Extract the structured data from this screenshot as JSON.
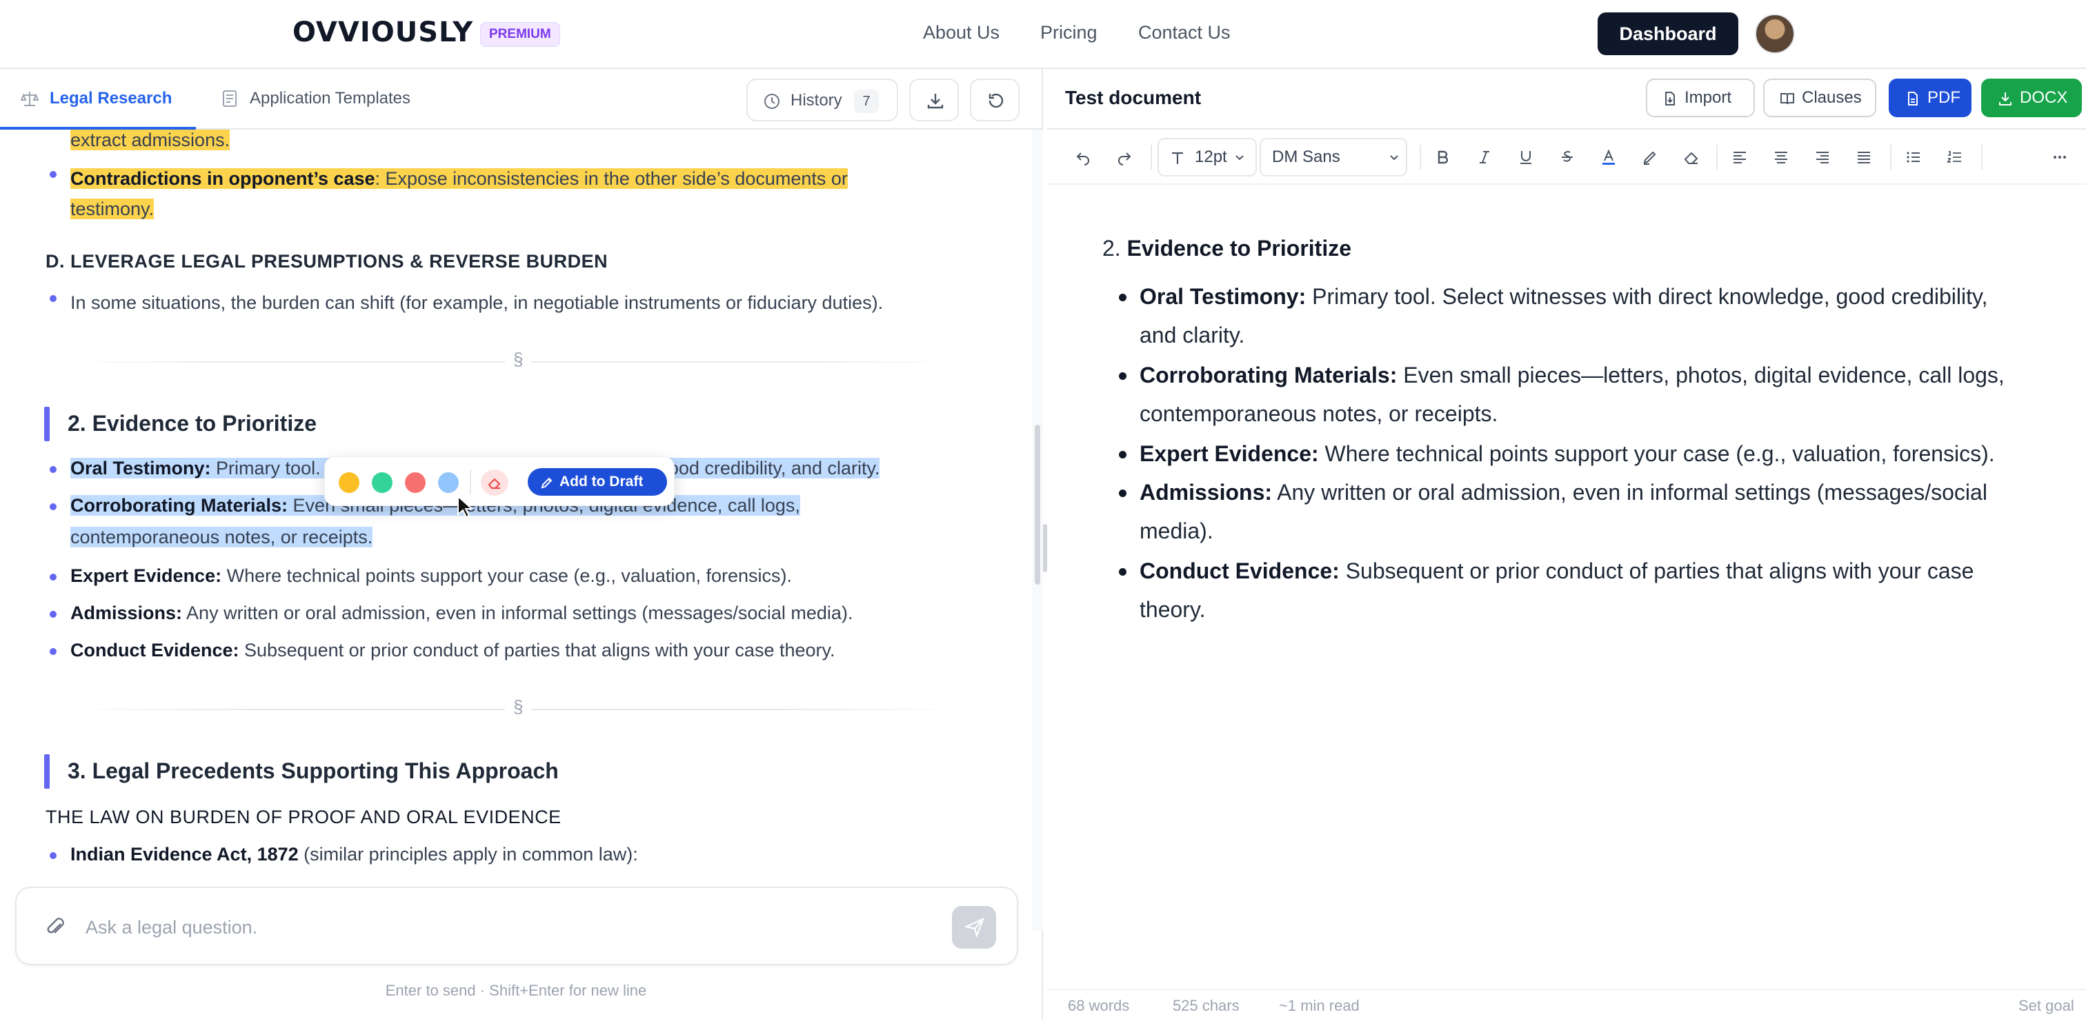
{
  "nav": {
    "logo": "OVVIOUSLY",
    "badge": "PREMIUM",
    "links": [
      "About Us",
      "Pricing",
      "Contact Us"
    ],
    "dashboard": "Dashboard"
  },
  "left": {
    "tabs": [
      "Legal Research",
      "Application Templates"
    ],
    "history_label": "History",
    "history_count": "7",
    "content": {
      "frag_top": "extract admissions.",
      "contradictions_bold": "Contradictions in opponent’s case",
      "contradictions_rest_1": ": Expose inconsistencies in the other side’s documents or",
      "contradictions_rest_2": "testimony.",
      "leverage_heading": "D. LEVERAGE LEGAL PRESUMPTIONS & REVERSE BURDEN",
      "leverage_item": "In some situations, the burden can shift (for example, in negotiable instruments or fiduciary duties).",
      "section_mark": "§",
      "section2_title": "2. Evidence to Prioritize",
      "items": [
        {
          "bold": "Oral Testimony:",
          "text_1": " Primary tool. Select witnesses with direct knowledge, good credibility, and clarity.",
          "text_2": ""
        },
        {
          "bold": "Corroborating Materials:",
          "text_1": " Even small pieces—letters, photos, digital evidence, call logs,",
          "text_2": "contemporaneous notes, or receipts."
        },
        {
          "bold": "Expert Evidence:",
          "text_1": " Where technical points support your case (e.g., valuation, forensics).",
          "text_2": ""
        },
        {
          "bold": "Admissions:",
          "text_1": " Any written or oral admission, even in informal settings (messages/social media).",
          "text_2": ""
        },
        {
          "bold": "Conduct Evidence:",
          "text_1": " Subsequent or prior conduct of parties that aligns with your case theory.",
          "text_2": ""
        }
      ],
      "section3_title": "3. Legal Precedents Supporting This Approach",
      "law_heading": "THE LAW ON BURDEN OF PROOF AND ORAL EVIDENCE",
      "cut_bold": "Indian Evidence Act, 1872",
      "cut_rest": " (similar principles apply in common law):"
    },
    "popover": {
      "colors": [
        "#fbbf24",
        "#34d399",
        "#f87171",
        "#93c5fd"
      ],
      "add_label": "Add to Draft"
    },
    "chat": {
      "placeholder": "Ask a legal question.",
      "hint": "Enter to send · Shift+Enter for new line"
    }
  },
  "right": {
    "title": "Test document",
    "buttons": {
      "import": "Import",
      "clauses": "Clauses",
      "pdf": "PDF",
      "docx": "DOCX"
    },
    "toolbar": {
      "font_size": "12pt",
      "font_family": "DM Sans"
    },
    "doc": {
      "heading_num": "2. ",
      "heading_bold": "Evidence to Prioritize",
      "items": [
        {
          "bold": "Oral Testimony:",
          "l1": " Primary tool. Select witnesses with direct knowledge, good credibility,",
          "l2": "and clarity."
        },
        {
          "bold": "Corroborating Materials:",
          "l1": " Even small pieces—letters, photos, digital evidence, call logs,",
          "l2": "contemporaneous notes, or receipts."
        },
        {
          "bold": "Expert Evidence:",
          "l1": " Where technical points support your case (e.g., valuation, forensics).",
          "l2": ""
        },
        {
          "bold": "Admissions:",
          "l1": " Any written or oral admission, even in informal settings (messages/social",
          "l2": "media)."
        },
        {
          "bold": "Conduct Evidence:",
          "l1": " Subsequent or prior conduct of parties that aligns with your case",
          "l2": "theory."
        }
      ]
    },
    "status": {
      "words": "68 words",
      "chars": "525 chars",
      "read": "~1 min read",
      "goal": "Set goal"
    }
  }
}
